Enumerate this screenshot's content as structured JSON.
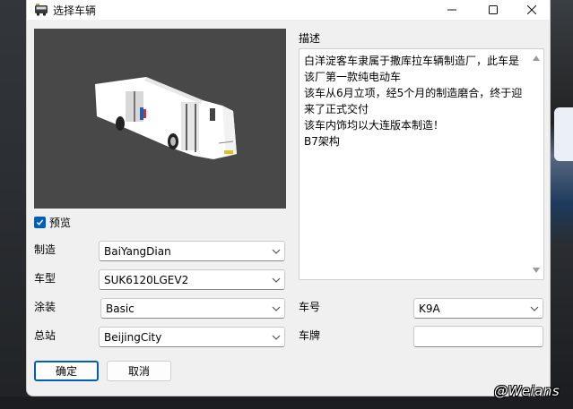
{
  "window": {
    "title": "选择车辆",
    "controls": {
      "minimize_icon": "minimize-icon",
      "maximize_icon": "maximize-icon",
      "close_icon": "close-icon"
    }
  },
  "preview": {
    "checkbox_label": "预览",
    "checked": true
  },
  "fields": {
    "manufacturer": {
      "label": "制造",
      "value": "BaiYangDian"
    },
    "model": {
      "label": "车型",
      "value": "SUK6120LGEV2"
    },
    "livery": {
      "label": "涂装",
      "value": "Basic"
    },
    "depot": {
      "label": "总站",
      "value": "BeijingCity"
    },
    "vehicle_number": {
      "label": "车号",
      "value": "K9A"
    },
    "license_plate": {
      "label": "车牌",
      "value": ""
    }
  },
  "description": {
    "label": "描述",
    "text": "白洋淀客车隶属于撒库拉车辆制造厂，此车是该厂第一款纯电动车\n该车从6月立项，经5个月的制造磨合，终于迎来了正式交付\n该车内饰均以大连版本制造！\nB7架构"
  },
  "buttons": {
    "ok": "确定",
    "cancel": "取消"
  },
  "watermark": "@Weians",
  "colors": {
    "accent": "#005fb8",
    "preview_bg": "#484848"
  }
}
